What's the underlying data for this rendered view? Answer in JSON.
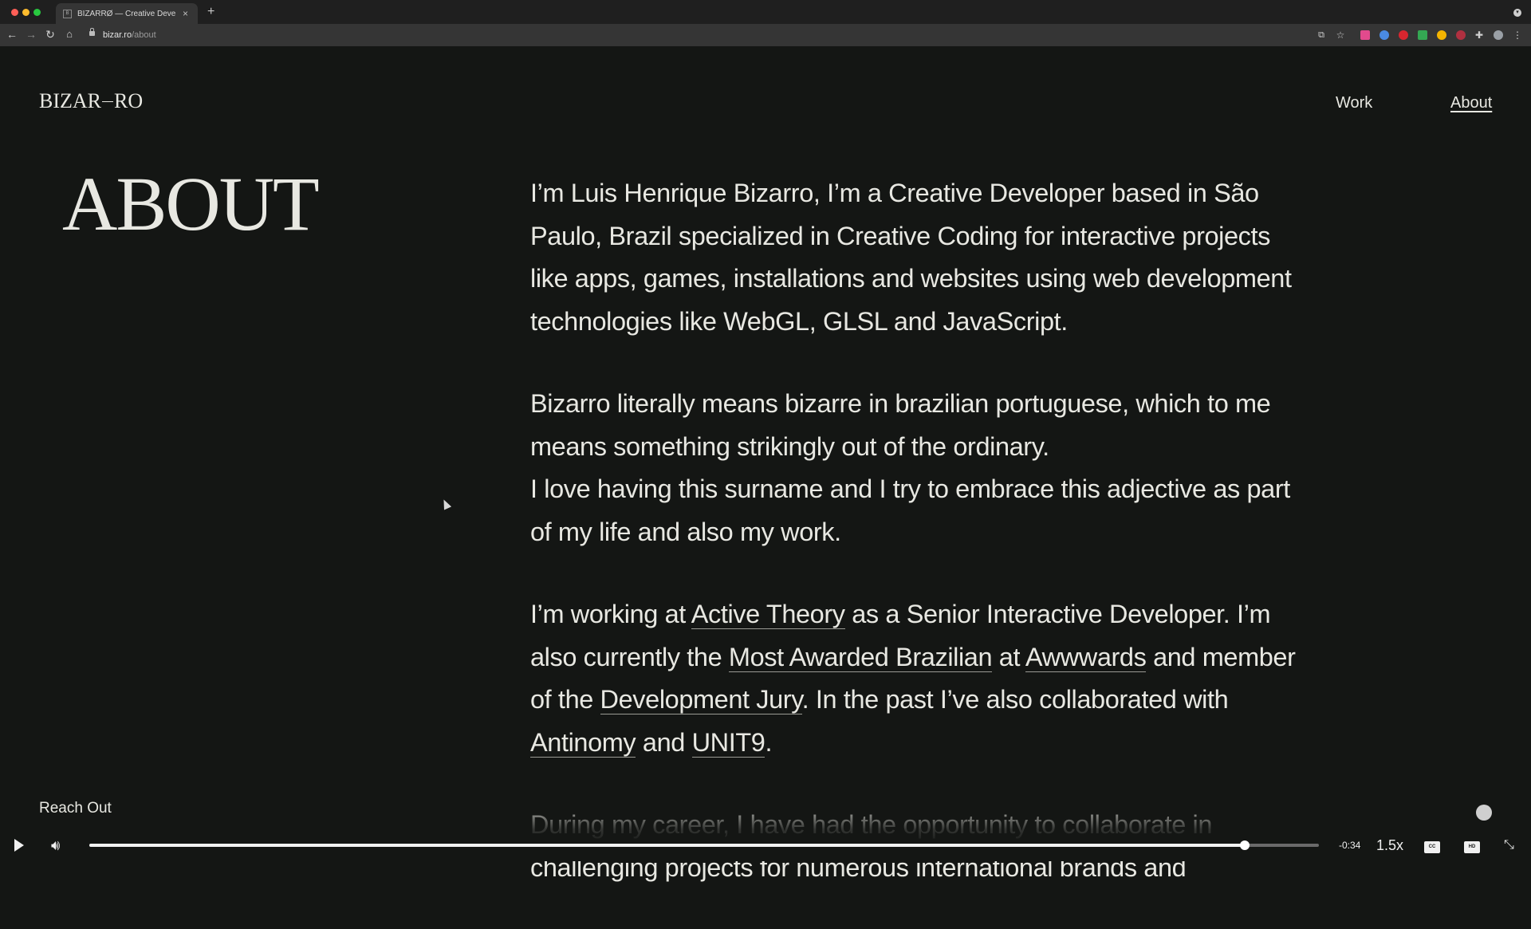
{
  "browser": {
    "tab_title": "BIZARRØ — Creative Developer",
    "tab_favicon": "B",
    "new_tab_symbol": "+",
    "close_symbol": "×",
    "url_host": "bizar.ro",
    "url_path": "/about"
  },
  "site": {
    "logo_left": "BIZAR",
    "logo_right": "RO",
    "nav": [
      {
        "label": "Work"
      },
      {
        "label": "About"
      }
    ],
    "page_title": "ABOUT",
    "paragraphs": {
      "p1": "I’m Luis Henrique Bizarro, I’m a Creative Developer based in São Paulo, Brazil specialized in Creative Coding for interactive projects like apps, games, installations and websites using web development technologies like WebGL, GLSL and JavaScript.",
      "p2a": "Bizarro literally means bizarre in brazilian portuguese, which to me means something strikingly out of the ordinary.",
      "p2b": "I love having this surname and I try to embrace this adjective as part of my life and also my work.",
      "p3": {
        "t1": "I’m working at ",
        "link1": "Active Theory",
        "t2": " as a Senior Interactive Developer. I’m also currently the ",
        "link2": "Most Awarded Brazilian",
        "t3": " at ",
        "link3": "Awwwards",
        "t4": " and member of the ",
        "link4": "Development Jury",
        "t5": ". In the past I’ve also collaborated with ",
        "link5": "Antinomy",
        "t6": " and ",
        "link6": "UNIT9",
        "t7": "."
      },
      "p4": "During my career, I have had the opportunity to collaborate in challenging projects for numerous international brands and"
    },
    "reach_out": "Reach Out"
  },
  "player": {
    "time_remaining": "-0:34",
    "speed": "1.5x",
    "progress": 0.94,
    "cc_label": "CC",
    "hd_label": "HD"
  }
}
